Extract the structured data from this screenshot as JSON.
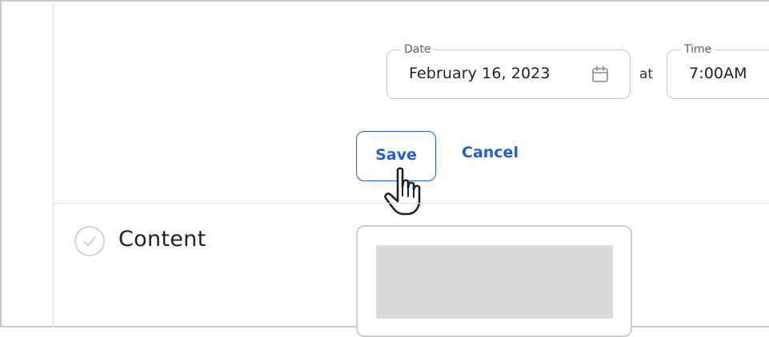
{
  "schedule": {
    "date_field": {
      "label": "Date",
      "value": "February 16, 2023",
      "icon": "calendar-icon"
    },
    "connector_label": "at",
    "time_field": {
      "label": "Time",
      "value": "7:00AM",
      "icon": "clock-icon"
    }
  },
  "actions": {
    "save_label": "Save",
    "cancel_label": "Cancel"
  },
  "content_section": {
    "title": "Content",
    "status_icon": "check-circle-icon"
  },
  "colors": {
    "accent": "#1f5fd6",
    "border": "#c7c7c7",
    "placeholder": "#d9d9d9"
  }
}
